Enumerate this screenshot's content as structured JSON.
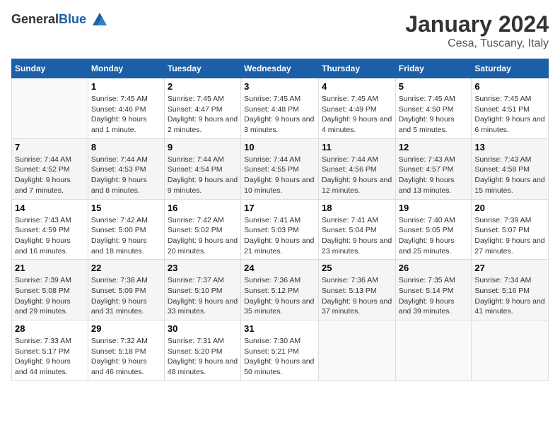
{
  "header": {
    "logo_general": "General",
    "logo_blue": "Blue",
    "month_title": "January 2024",
    "location": "Cesa, Tuscany, Italy"
  },
  "days_of_week": [
    "Sunday",
    "Monday",
    "Tuesday",
    "Wednesday",
    "Thursday",
    "Friday",
    "Saturday"
  ],
  "weeks": [
    {
      "cells": [
        {
          "day": "",
          "sunrise": "",
          "sunset": "",
          "daylight": ""
        },
        {
          "day": "1",
          "sunrise": "Sunrise: 7:45 AM",
          "sunset": "Sunset: 4:46 PM",
          "daylight": "Daylight: 9 hours and 1 minute."
        },
        {
          "day": "2",
          "sunrise": "Sunrise: 7:45 AM",
          "sunset": "Sunset: 4:47 PM",
          "daylight": "Daylight: 9 hours and 2 minutes."
        },
        {
          "day": "3",
          "sunrise": "Sunrise: 7:45 AM",
          "sunset": "Sunset: 4:48 PM",
          "daylight": "Daylight: 9 hours and 3 minutes."
        },
        {
          "day": "4",
          "sunrise": "Sunrise: 7:45 AM",
          "sunset": "Sunset: 4:49 PM",
          "daylight": "Daylight: 9 hours and 4 minutes."
        },
        {
          "day": "5",
          "sunrise": "Sunrise: 7:45 AM",
          "sunset": "Sunset: 4:50 PM",
          "daylight": "Daylight: 9 hours and 5 minutes."
        },
        {
          "day": "6",
          "sunrise": "Sunrise: 7:45 AM",
          "sunset": "Sunset: 4:51 PM",
          "daylight": "Daylight: 9 hours and 6 minutes."
        }
      ]
    },
    {
      "cells": [
        {
          "day": "7",
          "sunrise": "Sunrise: 7:44 AM",
          "sunset": "Sunset: 4:52 PM",
          "daylight": "Daylight: 9 hours and 7 minutes."
        },
        {
          "day": "8",
          "sunrise": "Sunrise: 7:44 AM",
          "sunset": "Sunset: 4:53 PM",
          "daylight": "Daylight: 9 hours and 8 minutes."
        },
        {
          "day": "9",
          "sunrise": "Sunrise: 7:44 AM",
          "sunset": "Sunset: 4:54 PM",
          "daylight": "Daylight: 9 hours and 9 minutes."
        },
        {
          "day": "10",
          "sunrise": "Sunrise: 7:44 AM",
          "sunset": "Sunset: 4:55 PM",
          "daylight": "Daylight: 9 hours and 10 minutes."
        },
        {
          "day": "11",
          "sunrise": "Sunrise: 7:44 AM",
          "sunset": "Sunset: 4:56 PM",
          "daylight": "Daylight: 9 hours and 12 minutes."
        },
        {
          "day": "12",
          "sunrise": "Sunrise: 7:43 AM",
          "sunset": "Sunset: 4:57 PM",
          "daylight": "Daylight: 9 hours and 13 minutes."
        },
        {
          "day": "13",
          "sunrise": "Sunrise: 7:43 AM",
          "sunset": "Sunset: 4:58 PM",
          "daylight": "Daylight: 9 hours and 15 minutes."
        }
      ]
    },
    {
      "cells": [
        {
          "day": "14",
          "sunrise": "Sunrise: 7:43 AM",
          "sunset": "Sunset: 4:59 PM",
          "daylight": "Daylight: 9 hours and 16 minutes."
        },
        {
          "day": "15",
          "sunrise": "Sunrise: 7:42 AM",
          "sunset": "Sunset: 5:00 PM",
          "daylight": "Daylight: 9 hours and 18 minutes."
        },
        {
          "day": "16",
          "sunrise": "Sunrise: 7:42 AM",
          "sunset": "Sunset: 5:02 PM",
          "daylight": "Daylight: 9 hours and 20 minutes."
        },
        {
          "day": "17",
          "sunrise": "Sunrise: 7:41 AM",
          "sunset": "Sunset: 5:03 PM",
          "daylight": "Daylight: 9 hours and 21 minutes."
        },
        {
          "day": "18",
          "sunrise": "Sunrise: 7:41 AM",
          "sunset": "Sunset: 5:04 PM",
          "daylight": "Daylight: 9 hours and 23 minutes."
        },
        {
          "day": "19",
          "sunrise": "Sunrise: 7:40 AM",
          "sunset": "Sunset: 5:05 PM",
          "daylight": "Daylight: 9 hours and 25 minutes."
        },
        {
          "day": "20",
          "sunrise": "Sunrise: 7:39 AM",
          "sunset": "Sunset: 5:07 PM",
          "daylight": "Daylight: 9 hours and 27 minutes."
        }
      ]
    },
    {
      "cells": [
        {
          "day": "21",
          "sunrise": "Sunrise: 7:39 AM",
          "sunset": "Sunset: 5:08 PM",
          "daylight": "Daylight: 9 hours and 29 minutes."
        },
        {
          "day": "22",
          "sunrise": "Sunrise: 7:38 AM",
          "sunset": "Sunset: 5:09 PM",
          "daylight": "Daylight: 9 hours and 31 minutes."
        },
        {
          "day": "23",
          "sunrise": "Sunrise: 7:37 AM",
          "sunset": "Sunset: 5:10 PM",
          "daylight": "Daylight: 9 hours and 33 minutes."
        },
        {
          "day": "24",
          "sunrise": "Sunrise: 7:36 AM",
          "sunset": "Sunset: 5:12 PM",
          "daylight": "Daylight: 9 hours and 35 minutes."
        },
        {
          "day": "25",
          "sunrise": "Sunrise: 7:36 AM",
          "sunset": "Sunset: 5:13 PM",
          "daylight": "Daylight: 9 hours and 37 minutes."
        },
        {
          "day": "26",
          "sunrise": "Sunrise: 7:35 AM",
          "sunset": "Sunset: 5:14 PM",
          "daylight": "Daylight: 9 hours and 39 minutes."
        },
        {
          "day": "27",
          "sunrise": "Sunrise: 7:34 AM",
          "sunset": "Sunset: 5:16 PM",
          "daylight": "Daylight: 9 hours and 41 minutes."
        }
      ]
    },
    {
      "cells": [
        {
          "day": "28",
          "sunrise": "Sunrise: 7:33 AM",
          "sunset": "Sunset: 5:17 PM",
          "daylight": "Daylight: 9 hours and 44 minutes."
        },
        {
          "day": "29",
          "sunrise": "Sunrise: 7:32 AM",
          "sunset": "Sunset: 5:18 PM",
          "daylight": "Daylight: 9 hours and 46 minutes."
        },
        {
          "day": "30",
          "sunrise": "Sunrise: 7:31 AM",
          "sunset": "Sunset: 5:20 PM",
          "daylight": "Daylight: 9 hours and 48 minutes."
        },
        {
          "day": "31",
          "sunrise": "Sunrise: 7:30 AM",
          "sunset": "Sunset: 5:21 PM",
          "daylight": "Daylight: 9 hours and 50 minutes."
        },
        {
          "day": "",
          "sunrise": "",
          "sunset": "",
          "daylight": ""
        },
        {
          "day": "",
          "sunrise": "",
          "sunset": "",
          "daylight": ""
        },
        {
          "day": "",
          "sunrise": "",
          "sunset": "",
          "daylight": ""
        }
      ]
    }
  ]
}
